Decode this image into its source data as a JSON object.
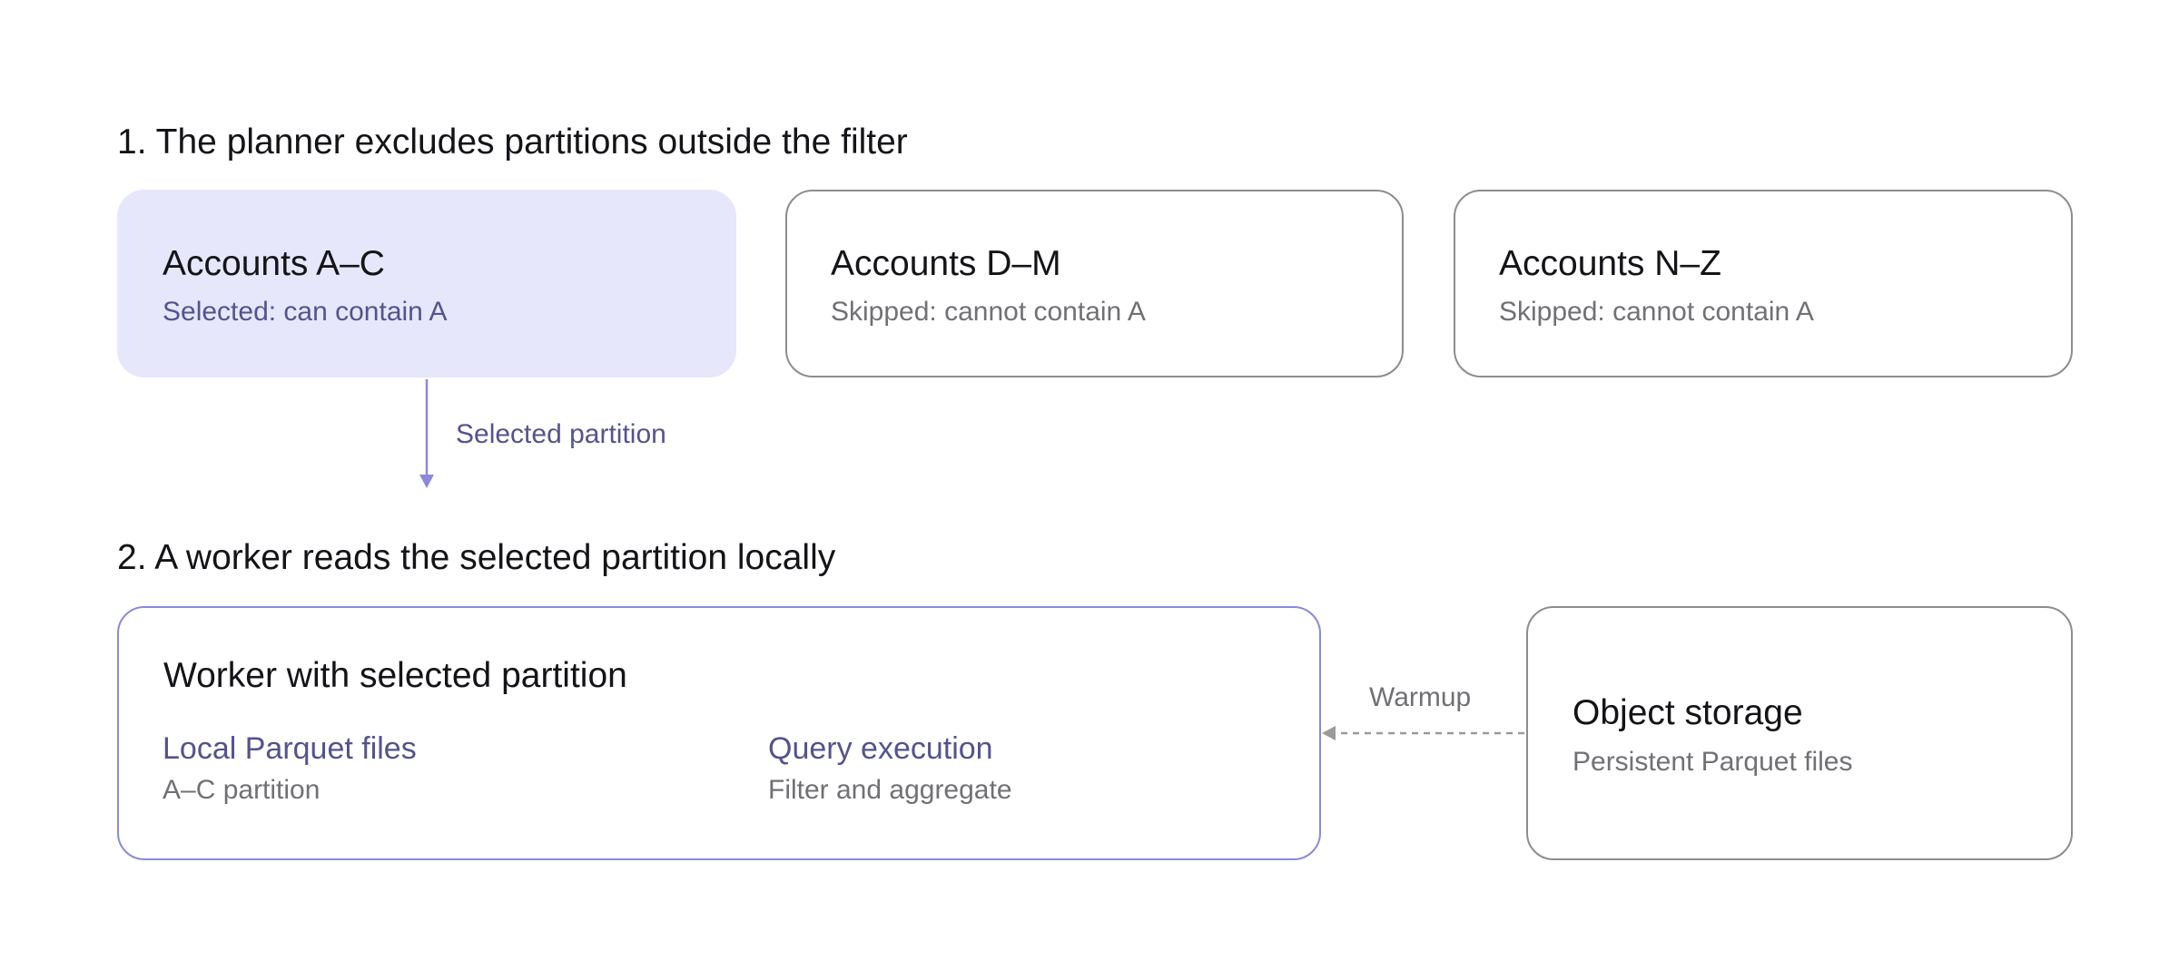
{
  "colors": {
    "accent": "#8b88dc",
    "accent_text": "#55528f",
    "selected_fill": "#e6e7fa",
    "neutral_border": "#8d8d8d",
    "muted_text": "#707075",
    "dashed_edge": "#9a9a9a"
  },
  "section1": {
    "title": "1. The planner excludes partitions outside the filter",
    "partitions": [
      {
        "title": "Accounts A–C",
        "subtitle": "Selected: can contain A",
        "state": "selected"
      },
      {
        "title": "Accounts D–M",
        "subtitle": "Skipped: cannot contain A",
        "state": "skipped"
      },
      {
        "title": "Accounts N–Z",
        "subtitle": "Skipped: cannot contain A",
        "state": "skipped"
      }
    ]
  },
  "edges": {
    "selected_partition_label": "Selected partition",
    "warmup_label": "Warmup"
  },
  "section2": {
    "title": "2. A worker reads the selected partition locally",
    "worker": {
      "title": "Worker with selected partition",
      "local_files": {
        "title": "Local Parquet files",
        "subtitle": "A–C partition"
      },
      "query": {
        "title": "Query execution",
        "subtitle": "Filter and aggregate"
      }
    },
    "storage": {
      "title": "Object storage",
      "subtitle": "Persistent Parquet files"
    }
  }
}
